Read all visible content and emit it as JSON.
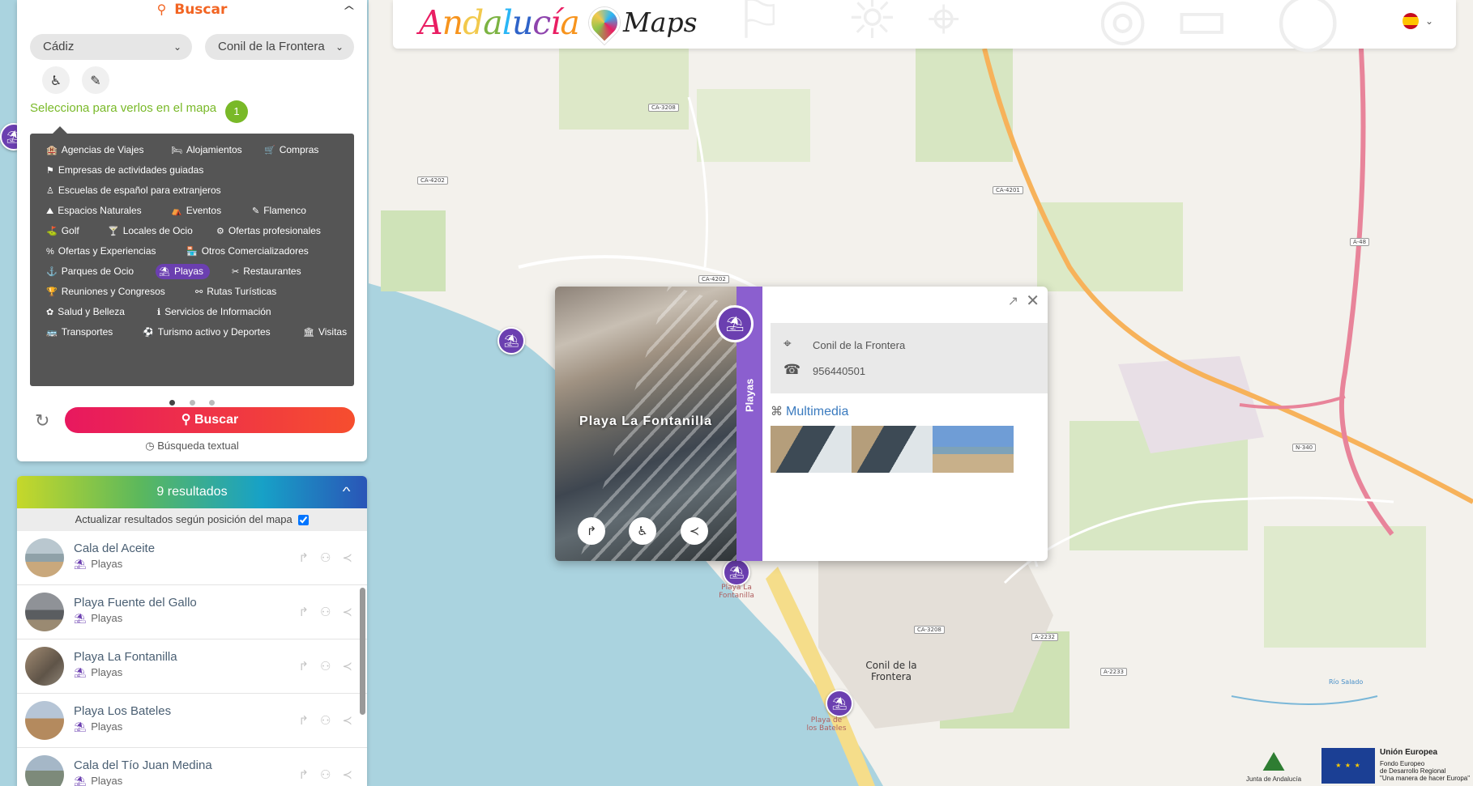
{
  "topbar": {
    "brand_letters": [
      "A",
      "n",
      "d",
      "a",
      "l",
      "u",
      "c",
      "í",
      "a"
    ],
    "brand_colors": [
      "#e91e63",
      "#f7941d",
      "#f2c94c",
      "#7cb342",
      "#29b6f6",
      "#2e63c9",
      "#8e44ad",
      "#e91e63",
      "#f7941d"
    ],
    "maps_label": "Maps",
    "language_icon": "spain-flag-icon",
    "language_chevron": "⌄"
  },
  "search": {
    "title": "Buscar",
    "title_icon": "search-icon",
    "province": "Cádiz",
    "municipality": "Conil de la Frontera",
    "chevron": "⌄",
    "hint": "Selecciona para verlos en el mapa",
    "selected_count": "1",
    "categories": [
      {
        "label": "Agencias de Viajes",
        "icon": "🏨",
        "active": false
      },
      {
        "label": "Alojamientos",
        "icon": "🛏",
        "active": false
      },
      {
        "label": "Compras",
        "icon": "🛒",
        "active": false
      },
      {
        "label": "Empresas de actividades guiadas",
        "icon": "⚑",
        "active": false
      },
      {
        "label": "Escuelas de español para extranjeros",
        "icon": "♙",
        "active": false
      },
      {
        "label": "Espacios Naturales",
        "icon": "⛰",
        "active": false
      },
      {
        "label": "Eventos",
        "icon": "⛺",
        "active": false
      },
      {
        "label": "Flamenco",
        "icon": "✎",
        "active": false
      },
      {
        "label": "Golf",
        "icon": "⛳",
        "active": false
      },
      {
        "label": "Locales de Ocio",
        "icon": "🍸",
        "active": false
      },
      {
        "label": "Ofertas profesionales",
        "icon": "⚙",
        "active": false
      },
      {
        "label": "Ofertas y Experiencias",
        "icon": "%",
        "active": false
      },
      {
        "label": "Otros Comercializadores",
        "icon": "🏪",
        "active": false
      },
      {
        "label": "Parques de Ocio",
        "icon": "⚓",
        "active": false
      },
      {
        "label": "Playas",
        "icon": "⛱",
        "active": true
      },
      {
        "label": "Restaurantes",
        "icon": "✂",
        "active": false
      },
      {
        "label": "Reuniones y Congresos",
        "icon": "🏆",
        "active": false
      },
      {
        "label": "Rutas Turísticas",
        "icon": "⚯",
        "active": false
      },
      {
        "label": "Salud y Belleza",
        "icon": "✿",
        "active": false
      },
      {
        "label": "Servicios de Información",
        "icon": "ℹ",
        "active": false
      },
      {
        "label": "Transportes",
        "icon": "🚌",
        "active": false
      },
      {
        "label": "Turismo activo y Deportes",
        "icon": "⚽",
        "active": false
      },
      {
        "label": "Visitas",
        "icon": "🏛",
        "active": false
      }
    ],
    "pages": 3,
    "current_page": 1,
    "search_button": "Buscar",
    "text_search": "Búsqueda textual"
  },
  "results": {
    "header": "9 resultados",
    "update_label": "Actualizar resultados según posición del mapa",
    "update_checked": true,
    "items": [
      {
        "name": "Cala del Aceite",
        "category": "Playas"
      },
      {
        "name": "Playa Fuente del Gallo",
        "category": "Playas"
      },
      {
        "name": "Playa La Fontanilla",
        "category": "Playas"
      },
      {
        "name": "Playa Los Bateles",
        "category": "Playas"
      },
      {
        "name": "Cala del Tío Juan Medina",
        "category": "Playas"
      }
    ]
  },
  "popup": {
    "title": "Playa La Fontanilla",
    "category": "Playas",
    "address": "Conil de la Frontera",
    "phone": "956440501",
    "media_title": "Multimedia",
    "media_count": 3
  },
  "map": {
    "roads": [
      "CA-3208",
      "CA-4202",
      "CA-4202",
      "CA-4201",
      "A-48",
      "N-340",
      "CA-3208",
      "A-2232",
      "A-2233"
    ],
    "town": "Conil de la Frontera",
    "marker_captions": [
      "Playa La Fontanilla",
      "Playa de los Bateles"
    ],
    "river": "Río Salado"
  },
  "footer": {
    "junta": "Junta de Andalucía",
    "eu_title": "Unión Europea",
    "eu_fund_1": "Fondo Europeo",
    "eu_fund_2": "de Desarrollo Regional",
    "eu_fund_3": "\"Una manera de hacer Europa\""
  }
}
